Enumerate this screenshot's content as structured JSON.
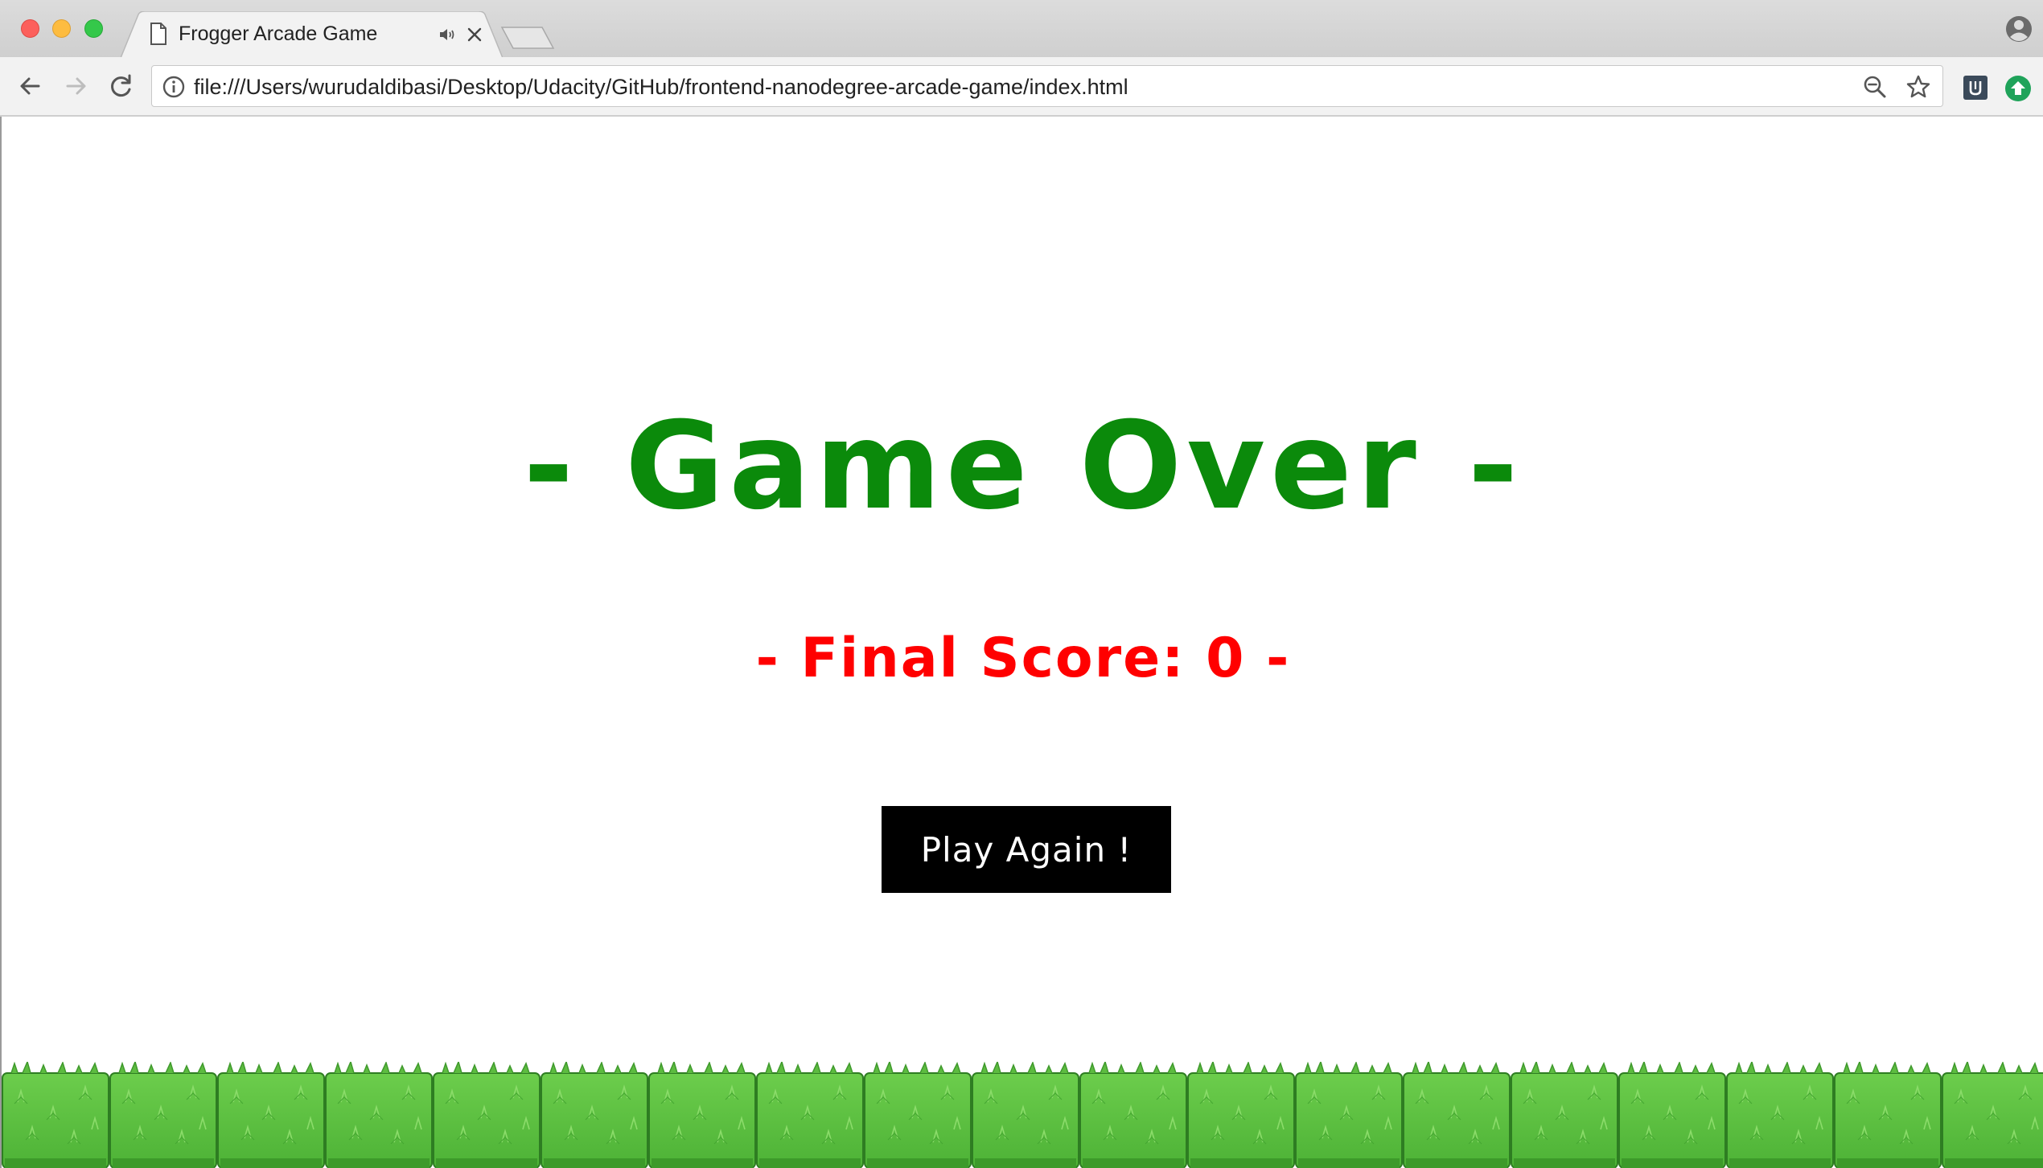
{
  "browser": {
    "tab": {
      "title": "Frogger Arcade Game",
      "favicon": "page-icon",
      "audio_icon": "speaker-icon",
      "close_icon": "close-icon"
    },
    "toolbar": {
      "back_icon": "back-arrow-icon",
      "forward_icon": "forward-arrow-icon",
      "reload_icon": "reload-icon",
      "info_icon": "info-icon",
      "url": "file:///Users/wurudaldibasi/Desktop/Udacity/GitHub/frontend-nanodegree-arcade-game/index.html",
      "zoom_icon": "zoom-out-icon",
      "bookmark_icon": "star-icon",
      "extensions": [
        "udacity-extension-icon",
        "green-upload-extension-icon"
      ],
      "profile_icon": "profile-icon"
    }
  },
  "game": {
    "heading": "- Game Over -",
    "final_score_text": "- Final Score: 0 -",
    "play_again_label": "Play Again !",
    "colors": {
      "heading": "#0b8a0b",
      "score": "#ff0000",
      "button_bg": "#000000",
      "button_text": "#ffffff",
      "grass": "#5cc33f"
    }
  }
}
